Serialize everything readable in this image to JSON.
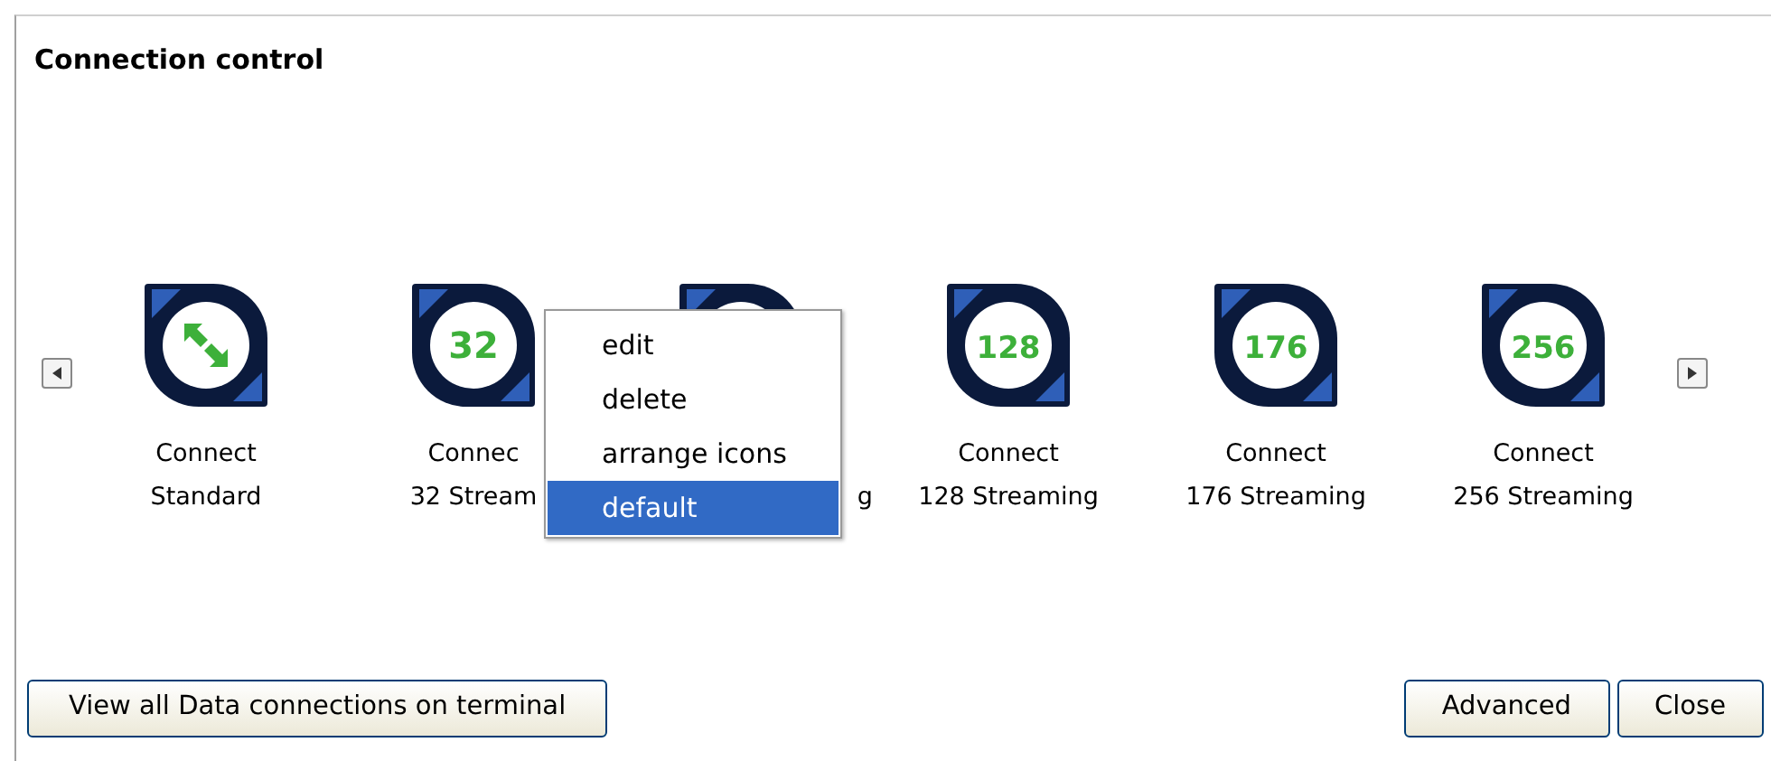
{
  "window": {
    "title": "Connection control"
  },
  "connections": [
    {
      "kind": "arrows",
      "lines": [
        "Connect",
        "Standard"
      ]
    },
    {
      "kind": "number",
      "badge": "32",
      "lines": [
        "Connec",
        "32 Stream"
      ]
    },
    {
      "kind": "covered",
      "lines": [
        "g"
      ]
    },
    {
      "kind": "number",
      "badge": "128",
      "lines": [
        "Connect",
        "128 Streaming"
      ]
    },
    {
      "kind": "number",
      "badge": "176",
      "lines": [
        "Connect",
        "176 Streaming"
      ]
    },
    {
      "kind": "number",
      "badge": "256",
      "lines": [
        "Connect",
        "256 Streaming"
      ]
    }
  ],
  "context_menu": [
    {
      "label": "edit",
      "selected": false
    },
    {
      "label": "delete",
      "selected": false
    },
    {
      "label": "arrange icons",
      "selected": false
    },
    {
      "label": "default",
      "selected": true
    }
  ],
  "buttons": {
    "left": "View all Data connections on terminal",
    "right": [
      "Advanced",
      "Close"
    ]
  }
}
